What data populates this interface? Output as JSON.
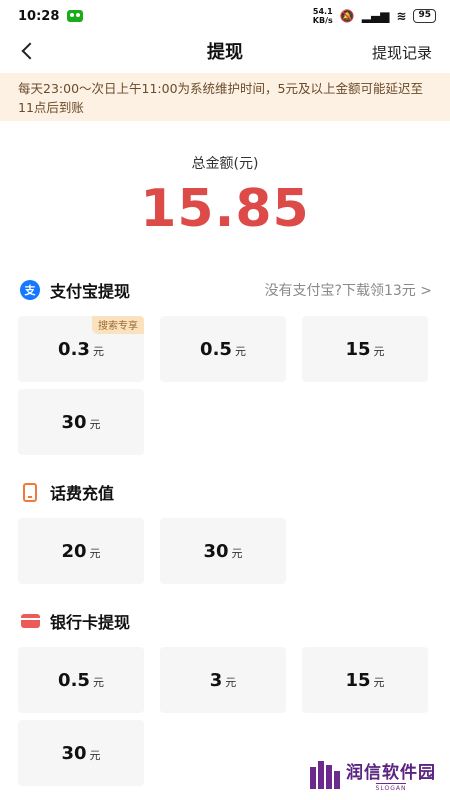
{
  "status_bar": {
    "time": "10:28",
    "net_speed_value": "54.1",
    "net_speed_unit": "KB/s",
    "battery": "95"
  },
  "header": {
    "title": "提现",
    "records_label": "提现记录"
  },
  "notice": "每天23:00～次日上午11:00为系统维护时间，5元及以上金额可能延迟至11点后到账",
  "balance": {
    "label": "总金额(元)",
    "amount": "15.85"
  },
  "sections": {
    "alipay": {
      "title": "支付宝提现",
      "link": "没有支付宝?下载领13元 >",
      "options": [
        {
          "value": "0.3",
          "unit": "元",
          "tag": "搜索专享"
        },
        {
          "value": "0.5",
          "unit": "元"
        },
        {
          "value": "15",
          "unit": "元"
        },
        {
          "value": "30",
          "unit": "元"
        }
      ]
    },
    "phone": {
      "title": "话费充值",
      "options": [
        {
          "value": "20",
          "unit": "元"
        },
        {
          "value": "30",
          "unit": "元"
        }
      ]
    },
    "bank": {
      "title": "银行卡提现",
      "options": [
        {
          "value": "0.5",
          "unit": "元"
        },
        {
          "value": "3",
          "unit": "元"
        },
        {
          "value": "15",
          "unit": "元"
        },
        {
          "value": "30",
          "unit": "元"
        }
      ]
    }
  },
  "watermark": {
    "name": "润信软件园",
    "slogan": "SLOGAN"
  },
  "colors": {
    "amount": "#dd4b48",
    "notice_bg": "#fdf1e4",
    "alipay_blue": "#1677ff",
    "phone_orange": "#f07a3a",
    "card_red": "#ec5a5a"
  },
  "icons": [
    "back-arrow-icon",
    "alipay-icon",
    "phone-icon",
    "bank-card-icon"
  ]
}
